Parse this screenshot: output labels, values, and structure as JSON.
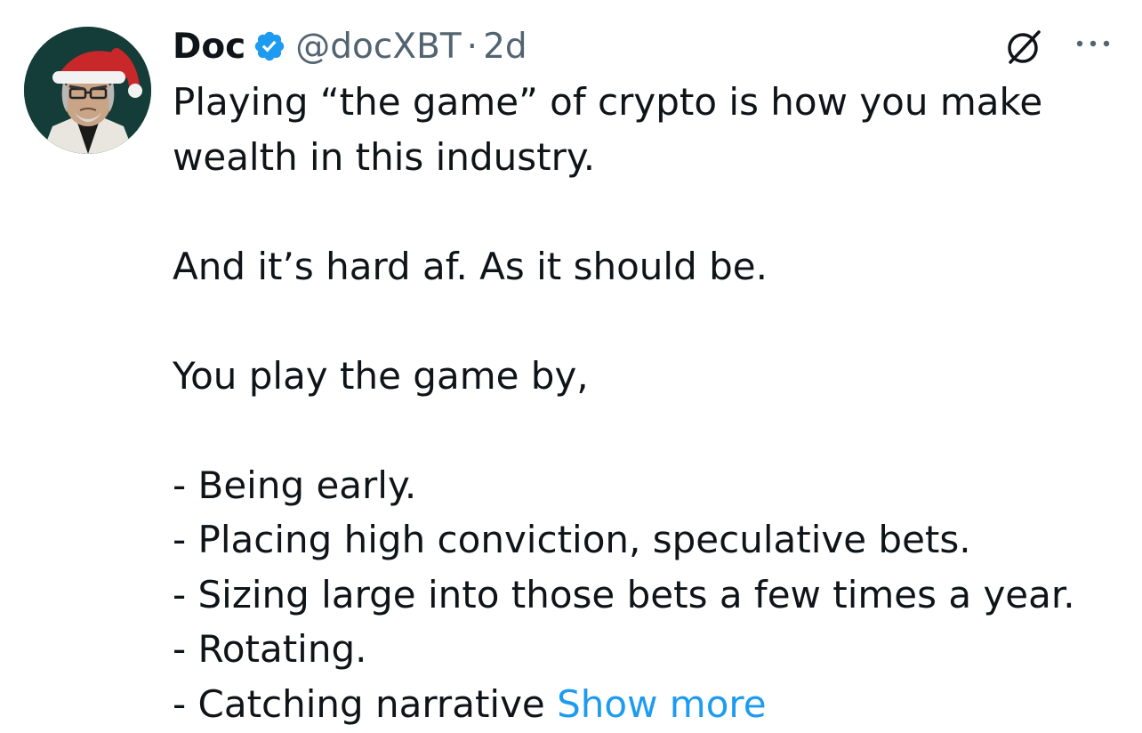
{
  "author": {
    "name": "Doc",
    "handle": "@docXBT",
    "separator": "·",
    "time": "2d"
  },
  "icons": {
    "avatar": "santa-hat-avatar",
    "verified": "verified-badge-icon",
    "grok": "grok-icon",
    "more": "more-options-icon"
  },
  "colors": {
    "text": "#0f1419",
    "secondary": "#536471",
    "link": "#1d9bf0",
    "verified": "#1d9bf0"
  },
  "tweet": {
    "lines": [
      "Playing “the game” of crypto is how you make",
      "wealth in this industry.",
      "",
      "And it’s hard af. As it should be.",
      "",
      "You play the game by,",
      "",
      "- Being early.",
      "- Placing high conviction, speculative bets.",
      "- Sizing large into those bets a few times a year.",
      "- Rotating.",
      "- Catching narrative "
    ],
    "show_more": "Show more"
  }
}
